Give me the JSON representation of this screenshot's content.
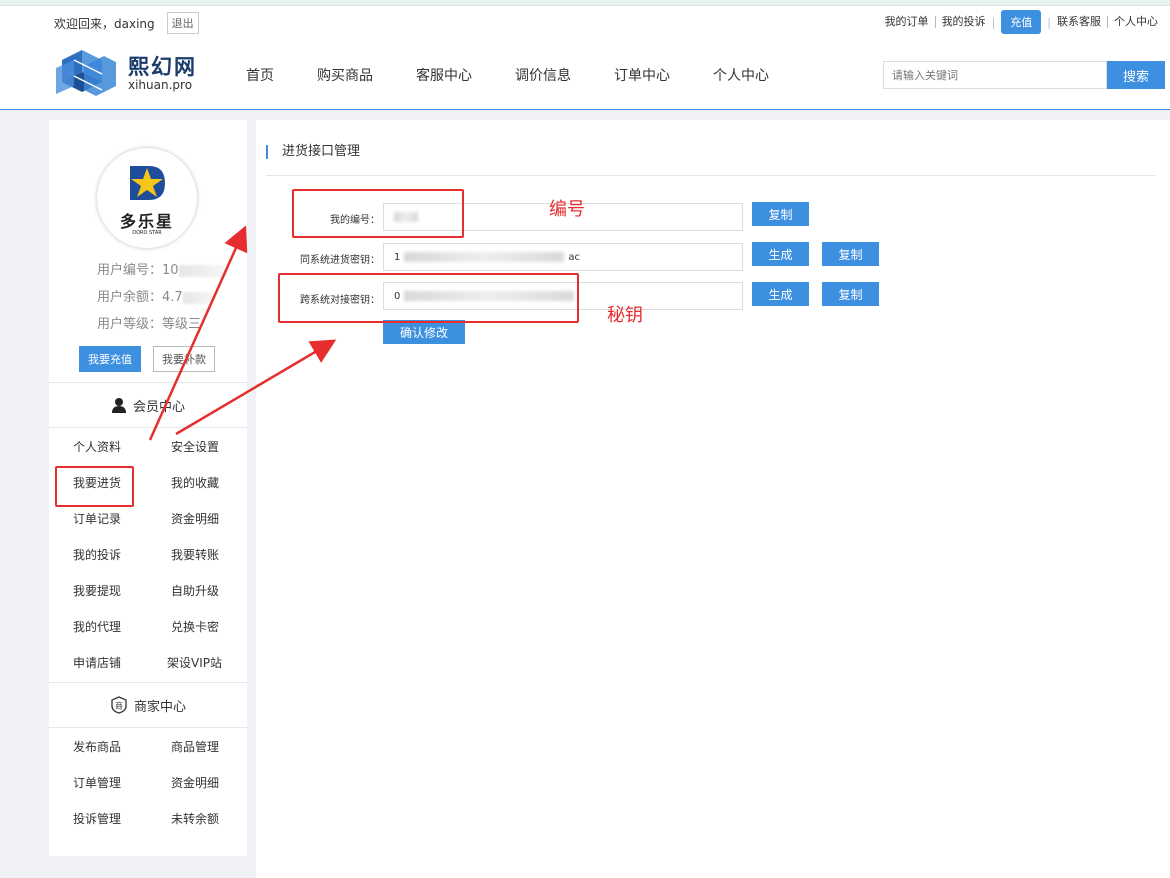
{
  "header": {
    "welcome": "欢迎回来，daxing",
    "logout": "退出",
    "top_links": {
      "my_orders": "我的订单",
      "my_complaints": "我的投诉",
      "recharge": "充值",
      "contact_service": "联系客服",
      "personal_center": "个人中心"
    },
    "logo_cn": "熙幻网",
    "logo_en": "xihuan.pro",
    "nav": [
      "首页",
      "购买商品",
      "客服中心",
      "调价信息",
      "订单中心",
      "个人中心"
    ],
    "search_placeholder": "请输入关键词",
    "search_button": "搜索"
  },
  "sidebar": {
    "avatar_brand_cn": "多乐星",
    "avatar_brand_en": "DORO STAR",
    "user_id_label": "用户编号：",
    "user_id_value": "10",
    "balance_label": "用户余额：",
    "balance_value": "4.7",
    "level_label": "用户等级：",
    "level_value": "等级三",
    "recharge_button": "我要充值",
    "repay_button": "我要补款",
    "member_center_title": "会员中心",
    "member_items": [
      "个人资料",
      "安全设置",
      "我要进货",
      "我的收藏",
      "订单记录",
      "资金明细",
      "我的投诉",
      "我要转账",
      "我要提现",
      "自助升级",
      "我的代理",
      "兑换卡密",
      "申请店铺",
      "架设VIP站"
    ],
    "merchant_center_title": "商家中心",
    "merchant_items": [
      "发布商品",
      "商品管理",
      "订单管理",
      "资金明细",
      "投诉管理",
      "未转余额"
    ]
  },
  "main": {
    "title": "进货接口管理",
    "fields": [
      {
        "label": "我的编号：",
        "value_prefix": "",
        "value_suffix": "",
        "buttons": [
          "复制"
        ]
      },
      {
        "label": "同系统进货密钥：",
        "value_prefix": "1",
        "value_suffix": "ac",
        "buttons": [
          "生成",
          "复制"
        ]
      },
      {
        "label": "跨系统对接密钥：",
        "value_prefix": "0",
        "value_suffix": "",
        "buttons": [
          "生成",
          "复制"
        ]
      }
    ],
    "confirm_button": "确认修改"
  },
  "annotations": {
    "id_note": "编号",
    "key_note": "秘钥",
    "color": "#e62e2e"
  },
  "colors": {
    "accent": "#3d8fe0"
  }
}
